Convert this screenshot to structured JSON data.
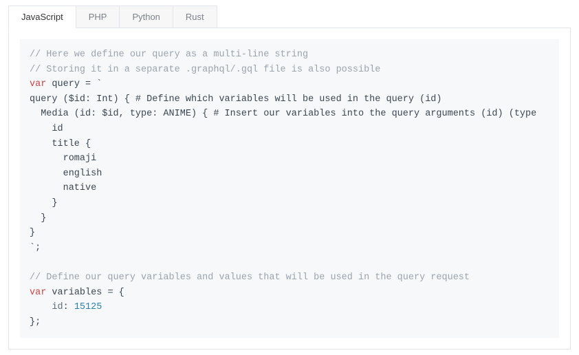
{
  "tabs": [
    {
      "label": "JavaScript",
      "active": true
    },
    {
      "label": "PHP",
      "active": false
    },
    {
      "label": "Python",
      "active": false
    },
    {
      "label": "Rust",
      "active": false
    }
  ],
  "code": {
    "comment1": "// Here we define our query as a multi-line string",
    "comment2": "// Storing it in a separate .graphql/.gql file is also possible",
    "var_kw": "var",
    "query_ident": "query",
    "equals_backtick": " = `",
    "line_query_open": "query ($id: Int) { # Define which variables will be used in the query (id)",
    "line_media": "  Media (id: $id, type: ANIME) { # Insert our variables into the query arguments (id) (type",
    "line_id": "    id",
    "line_title_open": "    title {",
    "line_romaji": "      romaji",
    "line_english": "      english",
    "line_native": "      native",
    "line_title_close": "    }",
    "line_media_close": "  }",
    "line_query_close": "}",
    "line_backtick_end": "`;",
    "blank": "",
    "comment3": "// Define our query variables and values that will be used in the query request",
    "variables_ident": "variables",
    "equals_brace": " = {",
    "id_key": "    id",
    "id_colon": ": ",
    "id_value": "15125",
    "close_brace": "};"
  }
}
